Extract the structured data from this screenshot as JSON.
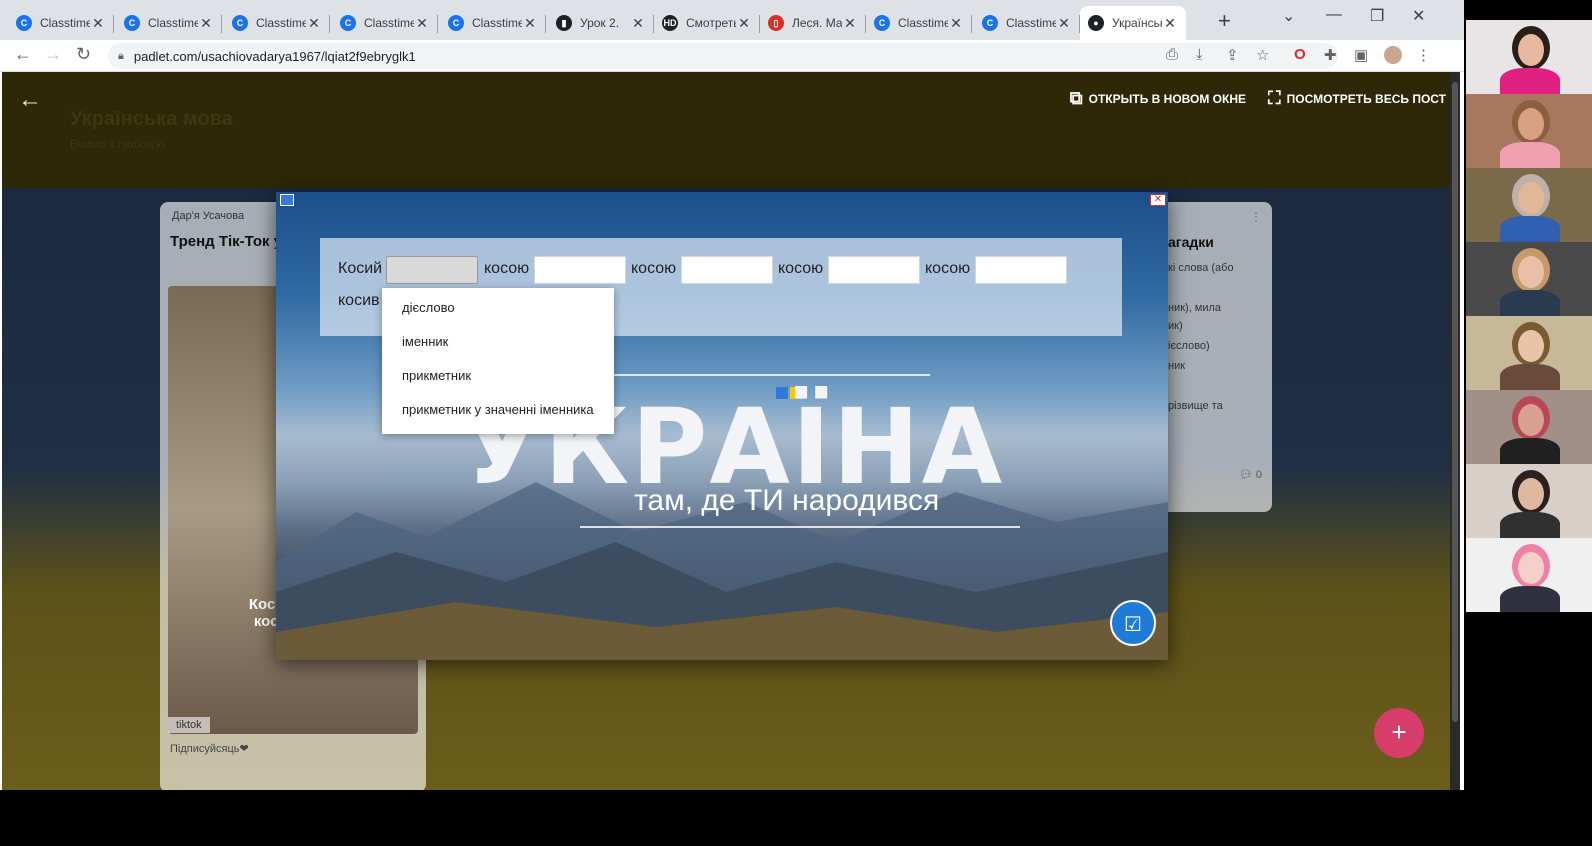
{
  "browser": {
    "tabs": [
      {
        "title": "Classtime",
        "favicon": "classtime",
        "color": "#1a73e8",
        "glyph": "C"
      },
      {
        "title": "Classtime",
        "favicon": "classtime",
        "color": "#1a73e8",
        "glyph": "C"
      },
      {
        "title": "Classtime",
        "favicon": "classtime",
        "color": "#1a73e8",
        "glyph": "C"
      },
      {
        "title": "Classtime",
        "favicon": "classtime",
        "color": "#1a73e8",
        "glyph": "C"
      },
      {
        "title": "Classtime",
        "favicon": "classtime",
        "color": "#1a73e8",
        "glyph": "C"
      },
      {
        "title": "Урок 2.",
        "favicon": "video",
        "color": "#202124",
        "glyph": "▮"
      },
      {
        "title": "Смотреть",
        "favicon": "hd",
        "color": "#202124",
        "glyph": "HD"
      },
      {
        "title": "Леся. Ма",
        "favicon": "pdf",
        "color": "#d93025",
        "glyph": "▯"
      },
      {
        "title": "Classtime",
        "favicon": "classtime",
        "color": "#1a73e8",
        "glyph": "C"
      },
      {
        "title": "Classtime",
        "favicon": "classtime",
        "color": "#1a73e8",
        "glyph": "C"
      },
      {
        "title": "Українськ",
        "favicon": "padlet",
        "color": "#202124",
        "glyph": "●",
        "active": true
      }
    ],
    "url": "padlet.com/usachiovadarya1967/lqiat2f9ebryglk1"
  },
  "padlet": {
    "title": "Українська мова",
    "subtitle": "Вчимо з любов'ю",
    "open_new_window": "ОТКРЫТЬ В НОВОМ ОКНЕ",
    "view_full_post": "ПОСМОТРЕТЬ ВЕСЬ ПОСТ",
    "left_card": {
      "author": "Дар'я Усачова",
      "title": "Тренд Тік-Ток української мо",
      "caption_1": "Косий з к",
      "caption_2": "косою к",
      "tag": "tiktok",
      "footer": "Підписуйсяць❤"
    },
    "right_card": {
      "title": "агадки",
      "lines": [
        "кі слова (або",
        "",
        "ник), мила",
        "ик)",
        "ієслово)",
        "ник",
        "",
        "різвище та"
      ],
      "comments": "0"
    }
  },
  "quiz": {
    "words": [
      "Косий",
      "косою",
      "косою",
      "косою",
      "косою",
      "косив"
    ],
    "options": [
      "дієслово",
      "іменник",
      "прикметник",
      "прикметник у значенні іменника"
    ]
  },
  "video": {
    "title": "УКРАЇНА",
    "subtitle": "там, де ТИ народився"
  },
  "colors": {
    "padlet_fab": "#d63d6b",
    "check_button": "#1e7bd8",
    "flag_blue": "#2f7ad8",
    "flag_yellow": "#f5c518"
  }
}
